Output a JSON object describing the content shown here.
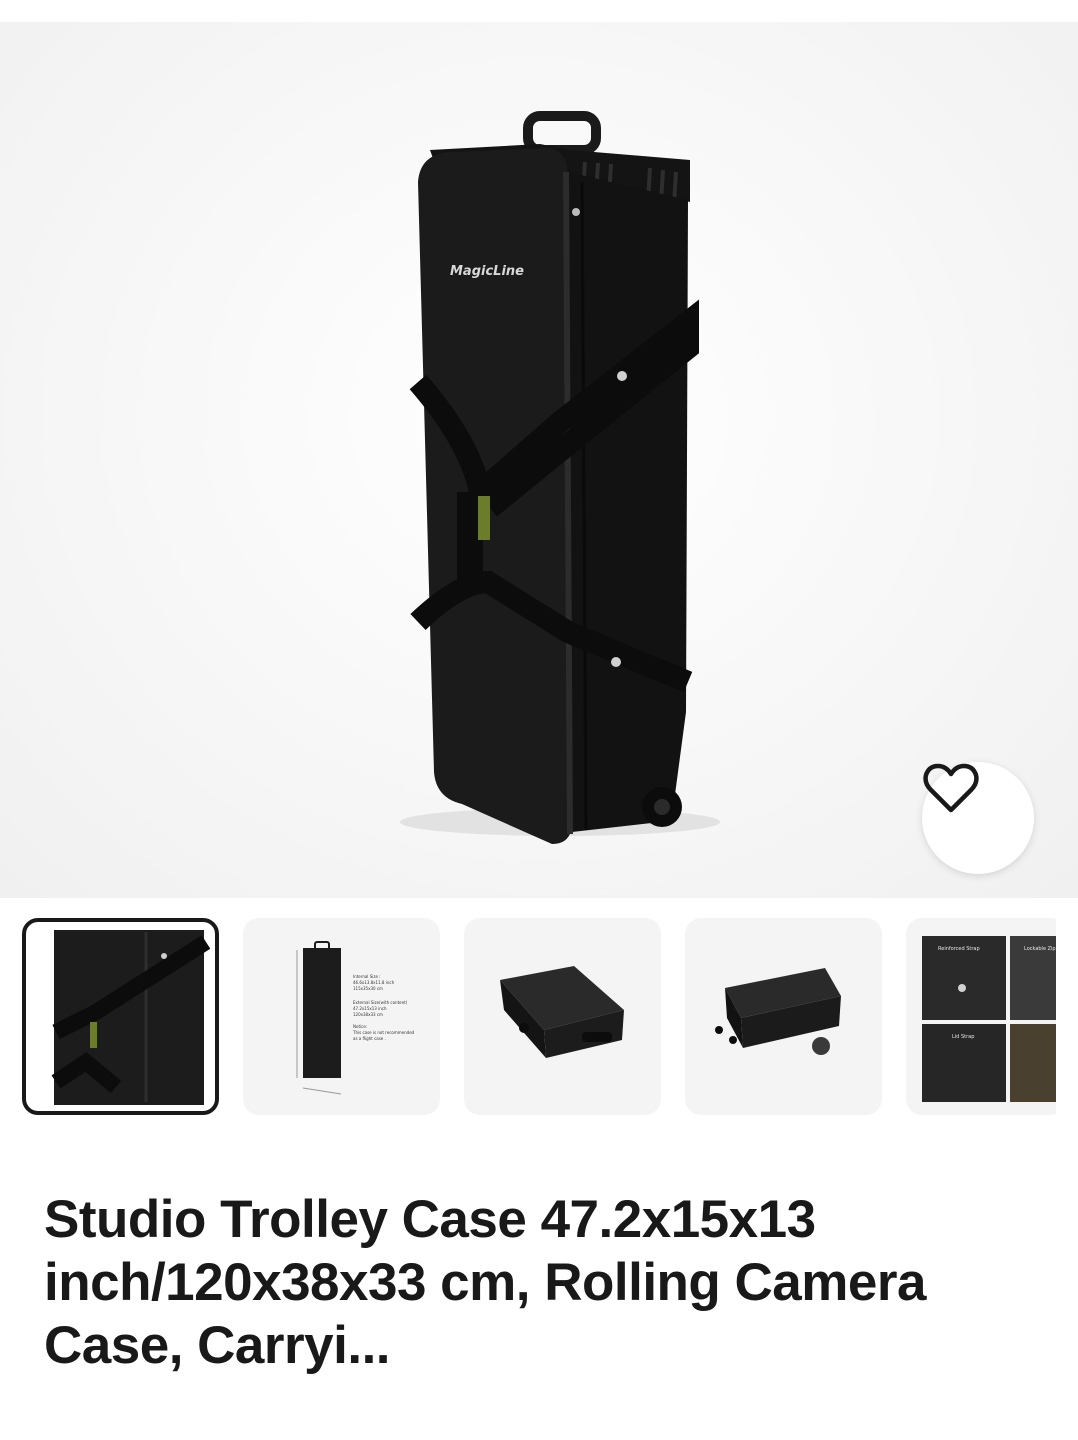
{
  "product": {
    "title": "Studio Trolley Case 47.2x15x13 inch/120x38x33 cm, Rolling Camera Case, Carryi...",
    "brand_logo": "MagicLine",
    "favorite_icon": "heart-outline-icon"
  },
  "gallery": {
    "selected_index": 0,
    "thumbnails": [
      {
        "name": "thumb-strap-closeup",
        "selected": true
      },
      {
        "name": "thumb-dimensions",
        "labels": [
          "Internal Size :",
          "46.6x13.8x11.8 inch",
          "115x35x30 cm",
          "External Size(with content)",
          "47.2x15x13 inch",
          "120x38x33 cm",
          "Notice:",
          "This case is not recommended",
          "as a flight case ."
        ]
      },
      {
        "name": "thumb-case-lying"
      },
      {
        "name": "thumb-case-wheels"
      },
      {
        "name": "thumb-details",
        "labels": [
          "Reinforced Strap",
          "Lockable Zip",
          "Lid Strap"
        ]
      }
    ]
  },
  "colors": {
    "title": "#191919",
    "selected_border": "#191919",
    "thumb_bg": "#f4f4f4"
  }
}
